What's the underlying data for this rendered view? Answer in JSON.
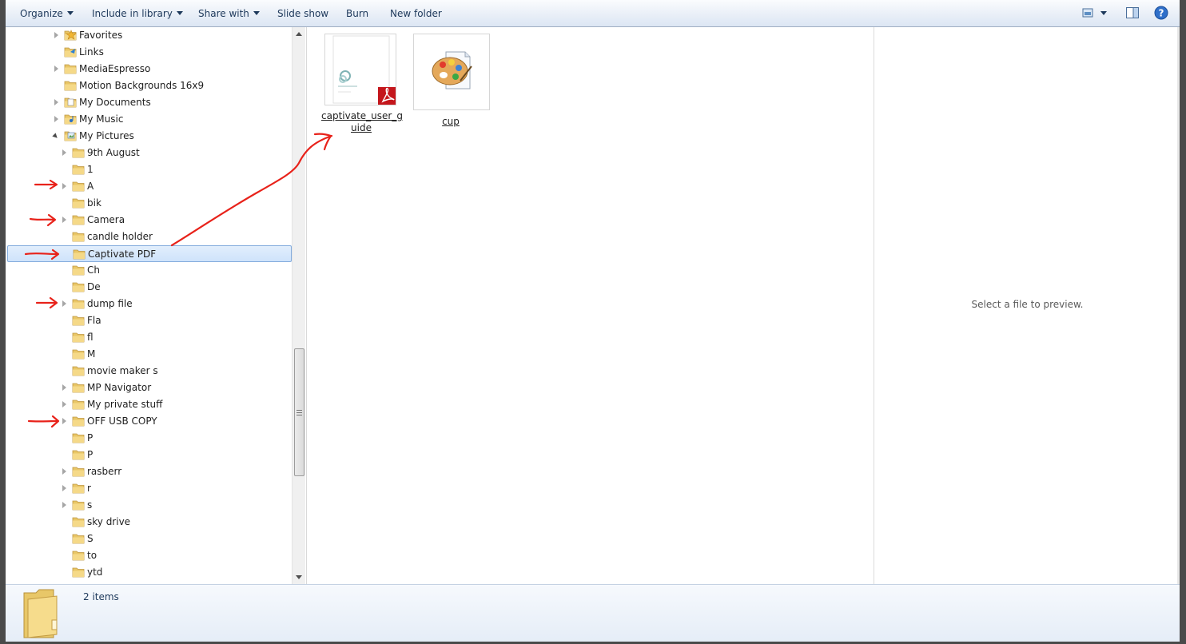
{
  "toolbar": {
    "organize": "Organize",
    "include_in_library": "Include in library",
    "share_with": "Share with",
    "slide_show": "Slide show",
    "burn": "Burn",
    "new_folder": "New folder",
    "icons": [
      "change-view-icon",
      "preview-pane-icon",
      "help-icon"
    ]
  },
  "nav": {
    "items": [
      {
        "label": "Favorites",
        "icon": "star-folder-icon"
      },
      {
        "label": "Links",
        "icon": "links-folder-icon"
      },
      {
        "label": "MediaEspresso",
        "icon": "folder-icon"
      },
      {
        "label": "Motion Backgrounds 16x9",
        "icon": "folder-icon"
      },
      {
        "label": "My Documents",
        "icon": "documents-folder-icon"
      },
      {
        "label": "My Music",
        "icon": "music-folder-icon"
      },
      {
        "label": "My Pictures",
        "icon": "pictures-folder-icon"
      },
      {
        "label": "9th August",
        "icon": "folder-icon"
      },
      {
        "label": "1",
        "icon": "folder-icon"
      },
      {
        "label": "A",
        "icon": "folder-icon"
      },
      {
        "label": "bik",
        "icon": "folder-icon"
      },
      {
        "label": "Camera",
        "icon": "folder-icon"
      },
      {
        "label": "candle holder",
        "icon": "folder-icon"
      },
      {
        "label": "Captivate PDF",
        "icon": "folder-icon",
        "selected": true
      },
      {
        "label": "Ch",
        "icon": "folder-icon"
      },
      {
        "label": "De",
        "icon": "folder-icon"
      },
      {
        "label": "dump file",
        "icon": "folder-icon"
      },
      {
        "label": "Fla",
        "icon": "folder-icon"
      },
      {
        "label": "fl",
        "icon": "folder-icon"
      },
      {
        "label": "M",
        "icon": "folder-icon"
      },
      {
        "label": "movie maker s",
        "icon": "folder-icon"
      },
      {
        "label": "MP Navigator",
        "icon": "folder-icon"
      },
      {
        "label": "My private stuff",
        "icon": "folder-icon"
      },
      {
        "label": "OFF USB COPY",
        "icon": "folder-icon"
      },
      {
        "label": "P",
        "icon": "folder-icon"
      },
      {
        "label": "P",
        "icon": "folder-icon"
      },
      {
        "label": "rasberr",
        "icon": "folder-icon"
      },
      {
        "label": "r",
        "icon": "folder-icon"
      },
      {
        "label": "s",
        "icon": "folder-icon"
      },
      {
        "label": "sky drive",
        "icon": "folder-icon"
      },
      {
        "label": "S",
        "icon": "folder-icon"
      },
      {
        "label": "to",
        "icon": "folder-icon"
      },
      {
        "label": "ytd",
        "icon": "folder-icon"
      }
    ]
  },
  "content": {
    "files": [
      {
        "name": "captivate_user_guide",
        "name_line1": "captivate_user_g",
        "name_line2": "uide",
        "icon": "pdf-document-icon"
      },
      {
        "name": "cup",
        "icon": "paint-palette-icon"
      }
    ]
  },
  "preview": {
    "text": "Select a file to preview."
  },
  "details": {
    "count": "2 items"
  },
  "colors": {
    "annotation": "#e8221a",
    "selection": "#cfe3fb",
    "toolbar_text": "#1e395b"
  }
}
